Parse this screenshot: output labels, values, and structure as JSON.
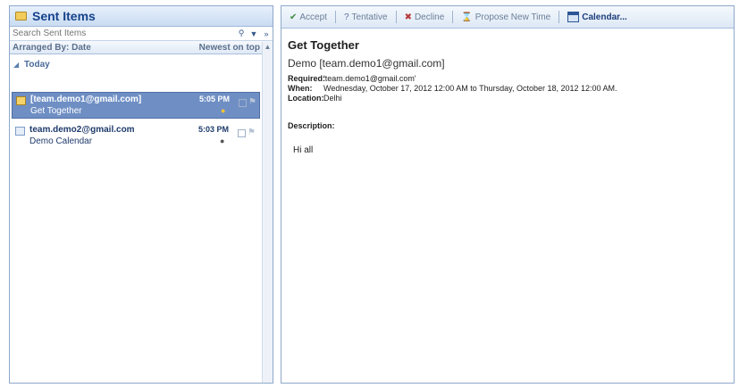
{
  "folder": {
    "title": "Sent Items",
    "search_placeholder": "Search Sent Items",
    "arranged_by": "Arranged By: Date",
    "sort_order": "Newest on top",
    "group_label": "Today"
  },
  "messages": [
    {
      "from": "[team.demo1@gmail.com]",
      "subject": "Get Together",
      "time": "5:05 PM",
      "selected": true
    },
    {
      "from": "team.demo2@gmail.com",
      "subject": "Demo Calendar",
      "time": "5:03 PM",
      "selected": false
    }
  ],
  "toolbar": {
    "accept": "Accept",
    "tentative": "Tentative",
    "decline": "Decline",
    "propose": "Propose New Time",
    "calendar": "Calendar..."
  },
  "reading": {
    "title": "Get Together",
    "sender": "Demo [team.demo1@gmail.com]",
    "required_label": "Required:",
    "required_value": "'team.demo1@gmail.com'",
    "when_label": "When:",
    "when_value": "Wednesday, October 17, 2012 12:00 AM to Thursday, October 18, 2012 12:00 AM.",
    "location_label": "Location:",
    "location_value": "Delhi",
    "description_label": "Description:",
    "body": "Hi all"
  },
  "colors": {
    "accent": "#15428b",
    "selection": "#6f8fc4",
    "pane_border": "#8ea8c9"
  }
}
